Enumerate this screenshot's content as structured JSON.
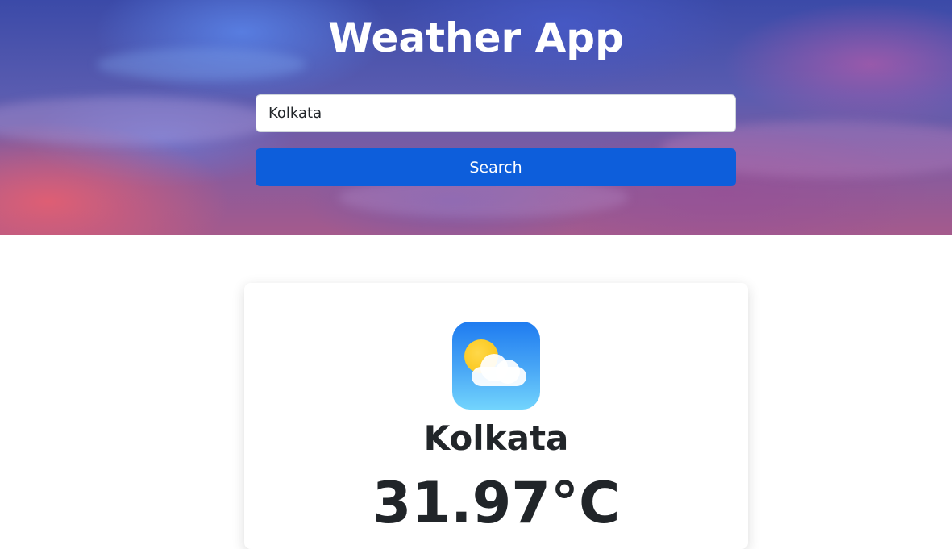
{
  "header": {
    "title": "Weather App"
  },
  "search": {
    "value": "Kolkata",
    "button_label": "Search"
  },
  "weather": {
    "icon": "partly-cloudy-icon",
    "city": "Kolkata",
    "temperature": "31.97°C"
  },
  "colors": {
    "button": "#0d5edb",
    "text": "#212529",
    "icon_gradient_top": "#1e7bf0",
    "icon_gradient_bottom": "#72d4fd",
    "sun": "#f9c10b"
  }
}
